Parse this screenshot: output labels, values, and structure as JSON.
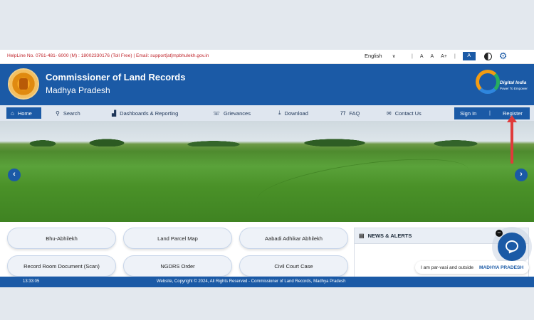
{
  "topbar": {
    "helpline": "HelpLine No.  0761-481- 6000 (M) : 18002330176 (Toll Free) | Email: support[at]mpbhulekh.gov.in",
    "language": "English",
    "sep": "|",
    "font_small": "A",
    "font_normal": "A",
    "font_large": "A+",
    "font_active": "A"
  },
  "header": {
    "title": "Commissioner of Land Records",
    "subtitle": "Madhya Pradesh",
    "digital_india": "Digital India",
    "digital_india_tagline": "Power To Empower"
  },
  "nav": {
    "home": "Home",
    "search": "Search",
    "dashboards": "Dashboards & Reporting",
    "grievances": "Grievances",
    "download": "Download",
    "faq": "FAQ",
    "contact": "Contact Us",
    "sign_in": "Sign In",
    "pipe": "|",
    "register": "Register"
  },
  "banner": {
    "prev": "‹",
    "next": "›"
  },
  "services": [
    "Bhu-Abhilekh",
    "Land Parcel Map",
    "Aabadi Adhikar Abhilekh",
    "Record Room Document (Scan)",
    "NGDRS Order",
    "Civil Court Case"
  ],
  "news": {
    "title": "NEWS & ALERTS"
  },
  "chat": {
    "tip_text": "I am par-vasi and outside",
    "tip_highlight": "MADHYA PRADESH"
  },
  "footer": {
    "time": "13:33:05",
    "copyright": "Website, Copyright © 2024, All Rights Reserved - Commissioner of Land Records, Madhya Pradesh"
  },
  "colors": {
    "primary": "#1b5aa6",
    "helpline": "#c0262d",
    "annotation": "#e03b3b"
  }
}
